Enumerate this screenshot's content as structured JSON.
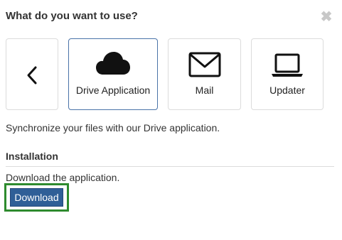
{
  "dialog": {
    "title": "What do you want to use?",
    "close_icon": "close-icon"
  },
  "options": {
    "back_icon": "chevron-left-icon",
    "items": [
      {
        "label": "Drive Application",
        "icon": "cloud-icon",
        "selected": true
      },
      {
        "label": "Mail",
        "icon": "envelope-icon",
        "selected": false
      },
      {
        "label": "Updater",
        "icon": "laptop-icon",
        "selected": false
      }
    ]
  },
  "description": "Synchronize your files with our Drive application.",
  "installation": {
    "heading": "Installation",
    "text": "Download the application.",
    "button_label": "Download"
  },
  "colors": {
    "accent": "#2f5f97",
    "highlight": "#2e8b2e"
  }
}
